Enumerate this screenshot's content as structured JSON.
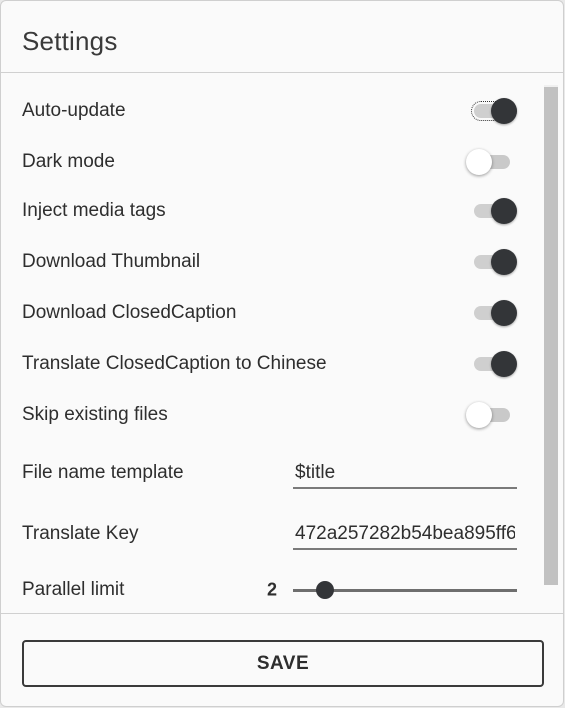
{
  "dialog": {
    "title": "Settings"
  },
  "settings": {
    "auto_update": {
      "label": "Auto-update",
      "enabled": true
    },
    "dark_mode": {
      "label": "Dark mode",
      "enabled": false
    },
    "inject_media_tags": {
      "label": "Inject media tags",
      "enabled": true
    },
    "download_thumbnail": {
      "label": "Download Thumbnail",
      "enabled": true
    },
    "download_closed_caption": {
      "label": "Download ClosedCaption",
      "enabled": true
    },
    "translate_closed_caption": {
      "label": "Translate ClosedCaption to Chinese",
      "enabled": true
    },
    "skip_existing_files": {
      "label": "Skip existing files",
      "enabled": false
    },
    "file_name_template": {
      "label": "File name template",
      "value": "$title"
    },
    "translate_key": {
      "label": "Translate Key",
      "value": "472a257282b54bea895ff6"
    },
    "parallel_limit": {
      "label": "Parallel limit",
      "value": "2",
      "level": 2
    }
  },
  "footer": {
    "save_label": "SAVE"
  },
  "colors": {
    "toggle_on_thumb": "#333538",
    "toggle_off_thumb": "#ffffff",
    "track": "#cfcfcf",
    "text": "#2e2e2e"
  }
}
